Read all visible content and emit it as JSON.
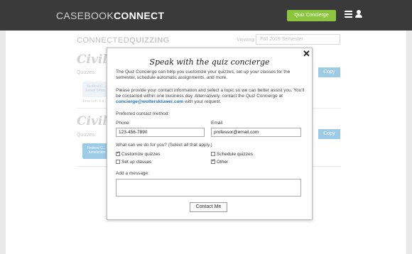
{
  "header": {
    "brand_light": "CASEBOOK",
    "brand_bold": "CONNECT",
    "quiz_concierge_label": "Quiz Concierge",
    "menu_icon": "hamburger-icon",
    "user_icon": "user-icon",
    "accent_color": "#8cc63f"
  },
  "page": {
    "title_light": "CONNECTED",
    "title_bold": "QUIZZING",
    "viewing_label": "Viewing:",
    "semester_value": "Fall 2019 Semester",
    "courses": [
      {
        "title": "Civil",
        "quizzes_label": "Quizzes:",
        "copy_label": "Copy",
        "card_text": "Federal C... Jurisdi Smith...",
        "time_left": "Time Left: 6 d..."
      },
      {
        "title": "Civil",
        "quizzes_label": "Quizzes:",
        "copy_label": "Copy",
        "card_text": "Federal C... Jurisdiction"
      }
    ]
  },
  "modal": {
    "title": "Speak with the quiz concierge",
    "intro": "The Quiz Concierge can help you customize your quizzes, set up your classes for the semester, schedule automatic assignments, and more.",
    "contact_text_before": "Please provide your contact information and select a topic so we can better assist you. You'll be contacted within one business day. Alternatively, contact the Quiz Concierge at ",
    "contact_email_link": "concierge@wolterskluwer.com",
    "contact_text_after": " with your request.",
    "preferred_method_label": "Preferred contact method:",
    "phone_label": "Phone",
    "phone_value": "123-456-7890",
    "email_label": "Email",
    "email_value": "professor@email.com",
    "topics_label": "What can we do for you? (Select all that apply.)",
    "topics": [
      {
        "label": "Customize quizzes",
        "checked": true
      },
      {
        "label": "Schedule quizzes",
        "checked": false
      },
      {
        "label": "Set up classes",
        "checked": false
      },
      {
        "label": "Other",
        "checked": true
      }
    ],
    "message_label": "Add a message:",
    "message_value": "",
    "submit_label": "Contact Me",
    "close_icon": "close-icon"
  }
}
